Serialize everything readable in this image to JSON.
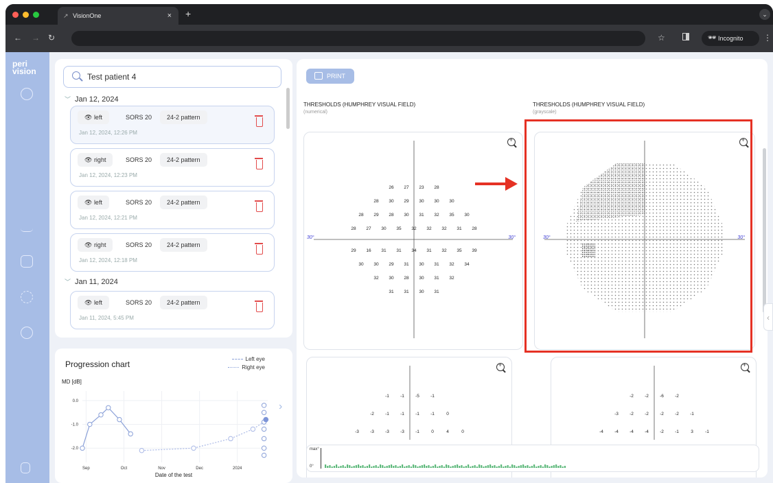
{
  "browser": {
    "tab_title": "VisionOne",
    "tab_close": "×",
    "new_tab": "+",
    "incognito_label": "Incognito"
  },
  "sidebar": {
    "logo_line1": "peri",
    "logo_line2": "vision"
  },
  "search": {
    "value": "Test patient 4"
  },
  "groups": [
    {
      "label": "Jan 12, 2024"
    },
    {
      "label": "Jan 11, 2024"
    }
  ],
  "tests": [
    {
      "eye": "left",
      "test": "SORS 20",
      "pattern": "24-2 pattern",
      "time": "Jan 12, 2024, 12:26 PM"
    },
    {
      "eye": "right",
      "test": "SORS 20",
      "pattern": "24-2 pattern",
      "time": "Jan 12, 2024, 12:23 PM"
    },
    {
      "eye": "left",
      "test": "SORS 20",
      "pattern": "24-2 pattern",
      "time": "Jan 12, 2024, 12:21 PM"
    },
    {
      "eye": "right",
      "test": "SORS 20",
      "pattern": "24-2 pattern",
      "time": "Jan 12, 2024, 12:18 PM"
    },
    {
      "eye": "left",
      "test": "SORS 20",
      "pattern": "24-2 pattern",
      "time": "Jan 11, 2024, 5:45 PM"
    }
  ],
  "progression": {
    "title": "Progression chart",
    "legend_left": "Left eye",
    "legend_right": "Right eye",
    "ylabel": "MD [dB]",
    "xlabel": "Date of the test"
  },
  "chart_data": {
    "type": "line",
    "title": "Progression chart",
    "xlabel": "Date of the test",
    "ylabel": "MD [dB]",
    "ylim": [
      -2.6,
      0.4
    ],
    "yticks": [
      "0.0",
      "-1.0",
      "-2.0"
    ],
    "xticks": [
      "Sep",
      "Oct",
      "Nov",
      "Dec",
      "2024"
    ],
    "series": [
      {
        "name": "Left eye",
        "x": [
          0.0,
          0.2,
          0.5,
          0.7,
          1.0,
          1.3
        ],
        "y": [
          -2.0,
          -1.0,
          -0.6,
          -0.3,
          -0.8,
          -1.4
        ]
      },
      {
        "name": "Right eye",
        "x": [
          1.6,
          3.0,
          4.0,
          4.6,
          4.9
        ],
        "y": [
          -2.1,
          -2.0,
          -1.6,
          -1.2,
          -0.9
        ]
      }
    ]
  },
  "main": {
    "print_label": "PRINT",
    "numeric_title": "THRESHOLDS (HUMPHREY VISUAL FIELD)",
    "numeric_sub": "(numerical)",
    "gray_title": "THRESHOLDS (HUMPHREY VISUAL FIELD)",
    "gray_sub": "(grayscale)",
    "deg_left": "30°",
    "deg_right": "30°",
    "strip_top": "max°",
    "strip_bottom": "0°"
  },
  "thresholds": [
    [
      "26",
      "27",
      "23",
      "28"
    ],
    [
      "28",
      "30",
      "29",
      "30",
      "30",
      "30"
    ],
    [
      "28",
      "29",
      "28",
      "30",
      "31",
      "32",
      "35",
      "30"
    ],
    [
      "28",
      "27",
      "30",
      "35",
      "32",
      "32",
      "32",
      "31",
      "28"
    ],
    [
      "29",
      "16",
      "31",
      "31",
      "34",
      "31",
      "32",
      "35",
      "39"
    ],
    [
      "30",
      "30",
      "29",
      "31",
      "30",
      "31",
      "32",
      "34"
    ],
    [
      "32",
      "30",
      "28",
      "30",
      "31",
      "32"
    ],
    [
      "31",
      "31",
      "30",
      "31"
    ]
  ],
  "deviation_left": [
    [
      "-1",
      "-1",
      "-5",
      "-1"
    ],
    [
      "-2",
      "-1",
      "-1",
      "-1",
      "-1",
      "0"
    ],
    [
      "-3",
      "-3",
      "-3",
      "-3",
      "-1",
      "0",
      "4",
      "0"
    ]
  ],
  "deviation_right": [
    [
      "-2",
      "-2",
      "-6",
      "-2"
    ],
    [
      "-3",
      "-2",
      "-2",
      "-2",
      "-2",
      "-1"
    ],
    [
      "-4",
      "-4",
      "-4",
      "-4",
      "-2",
      "-1",
      "3",
      "-1"
    ]
  ]
}
